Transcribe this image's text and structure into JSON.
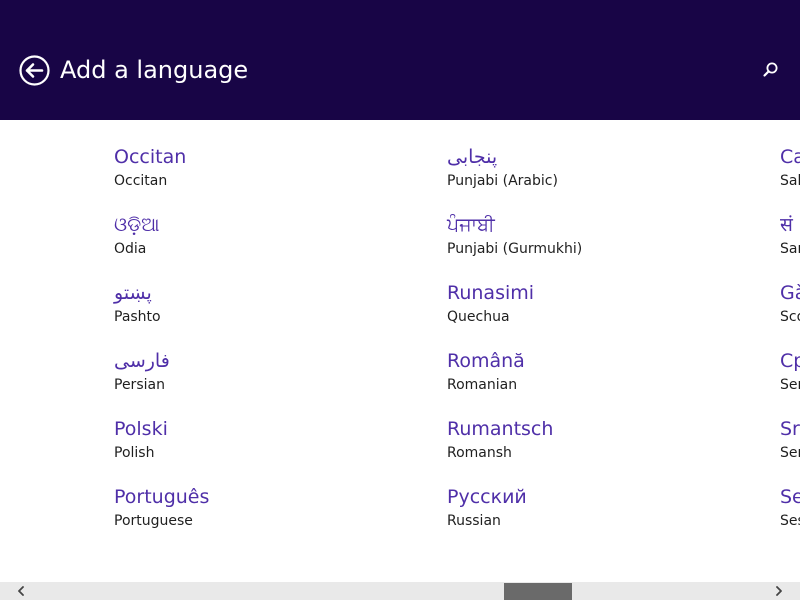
{
  "header": {
    "title": "Add a language",
    "back_icon": "back-arrow-circle-icon",
    "search_icon": "search-icon",
    "background": "#180546"
  },
  "languages": {
    "columns": [
      [
        {
          "native": "Occitan",
          "english": "Occitan"
        },
        {
          "native": "ଓଡ଼ିଆ",
          "english": "Odia"
        },
        {
          "native": "پښتو",
          "english": "Pashto"
        },
        {
          "native": "فارسی",
          "english": "Persian"
        },
        {
          "native": "Polski",
          "english": "Polish"
        },
        {
          "native": "Português",
          "english": "Portuguese"
        }
      ],
      [
        {
          "native": "پنجابی",
          "english": "Punjabi (Arabic)"
        },
        {
          "native": "ਪੰਜਾਬੀ",
          "english": "Punjabi (Gurmukhi)"
        },
        {
          "native": "Runasimi",
          "english": "Quechua"
        },
        {
          "native": "Română",
          "english": "Romanian"
        },
        {
          "native": "Rumantsch",
          "english": "Romansh"
        },
        {
          "native": "Русский",
          "english": "Russian"
        }
      ],
      [
        {
          "native": "Ca",
          "english": "Sak"
        },
        {
          "native": "सं",
          "english": "San"
        },
        {
          "native": "Gà",
          "english": "Sco"
        },
        {
          "native": "Ср",
          "english": "Ser"
        },
        {
          "native": "Sr",
          "english": "Ser"
        },
        {
          "native": "Se",
          "english": "Ses"
        }
      ]
    ]
  },
  "colors": {
    "accent": "#4f2fa8",
    "text": "#1f1f1f",
    "scrollbar_track": "#e9e9e9",
    "scrollbar_thumb": "#6a6a6a"
  },
  "scrollbar": {
    "left_icon": "chevron-left-icon",
    "right_icon": "chevron-right-icon"
  }
}
